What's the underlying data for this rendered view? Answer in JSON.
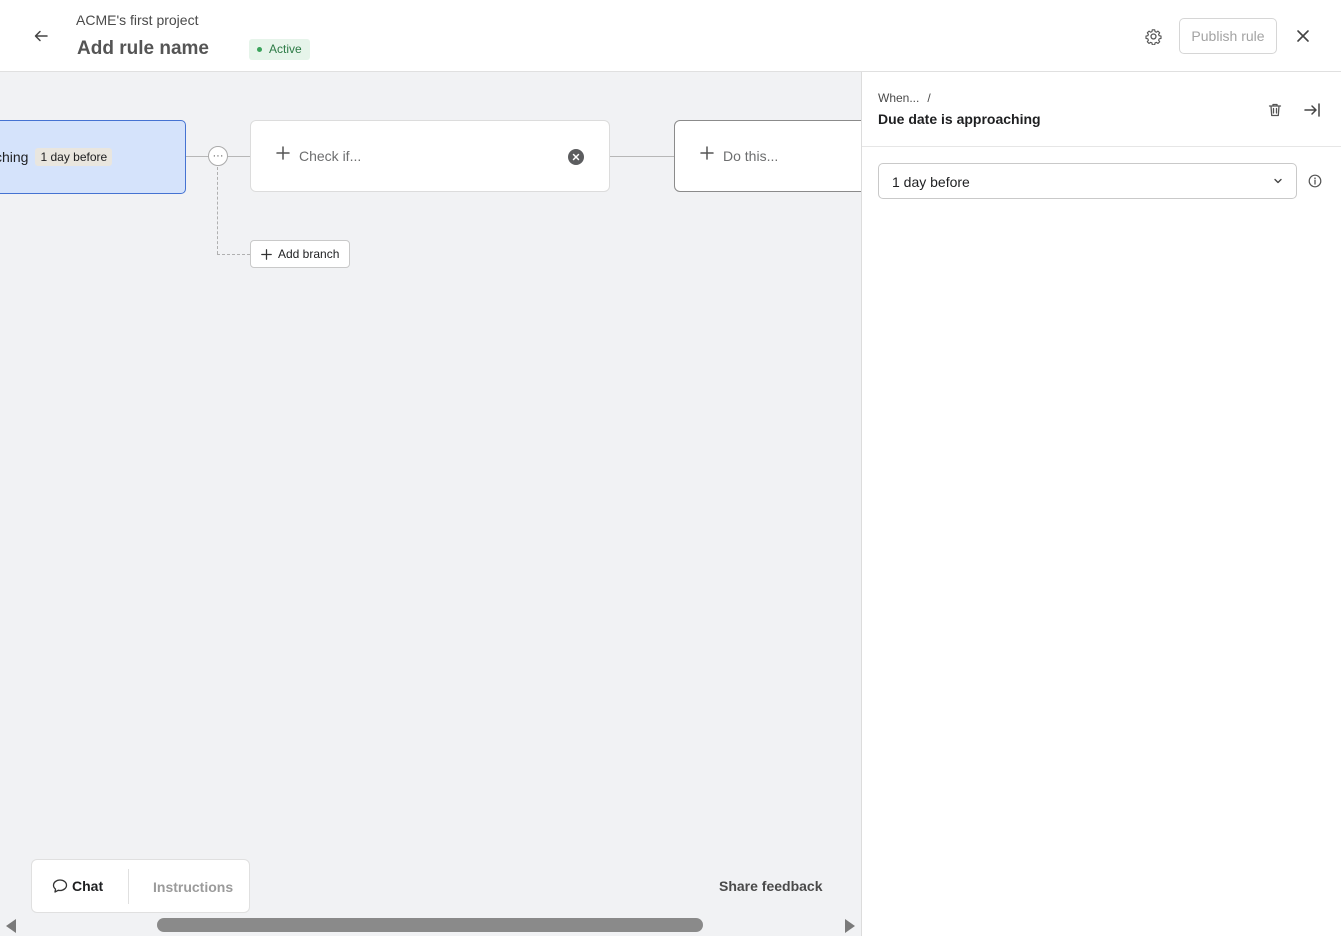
{
  "header": {
    "project_name": "ACME's first project",
    "rule_name": "Add rule name",
    "status": "Active",
    "publish_label": "Publish rule",
    "icons": {
      "back": "arrow-left-icon",
      "settings": "gear-icon",
      "close": "close-icon"
    }
  },
  "canvas": {
    "trigger": {
      "label": "ching",
      "chip": "1 day before"
    },
    "check_node": {
      "label": "Check if..."
    },
    "do_node": {
      "label": "Do this..."
    },
    "add_branch_label": "Add branch",
    "more_label": "···"
  },
  "footer": {
    "chat_label": "Chat",
    "instructions_label": "Instructions",
    "share_feedback_label": "Share feedback"
  },
  "panel": {
    "breadcrumb": "When...",
    "breadcrumb_sep": "/",
    "title": "Due date is approaching",
    "select_value": "1 day before",
    "icons": {
      "delete": "trash-icon",
      "collapse": "collapse-right-icon",
      "info": "info-icon"
    }
  },
  "colors": {
    "accent_blue": "#4573d2",
    "trigger_bg": "#d5e3fb",
    "status_green": "#2c7a45",
    "canvas_bg": "#f1f2f4"
  }
}
